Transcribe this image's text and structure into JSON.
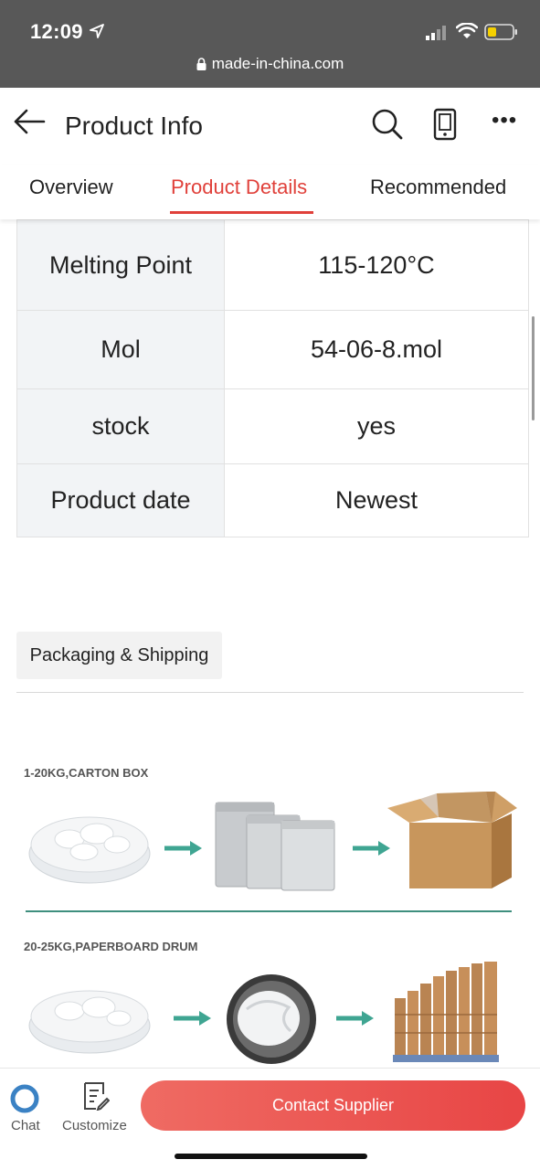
{
  "status_bar": {
    "time": "12:09"
  },
  "url_bar": {
    "domain": "made-in-china.com"
  },
  "header": {
    "title": "Product Info"
  },
  "tabs": [
    {
      "label": "Overview",
      "active": false
    },
    {
      "label": "Product Details",
      "active": true
    },
    {
      "label": "Recommended",
      "active": false
    }
  ],
  "spec_rows": [
    {
      "key": "Melting Point",
      "value": "115-120°C"
    },
    {
      "key": "Mol",
      "value": "54-06-8.mol"
    },
    {
      "key": "stock",
      "value": "yes"
    },
    {
      "key": "Product date",
      "value": "Newest"
    }
  ],
  "packaging": {
    "section_label": "Packaging & Shipping",
    "option1_label": "1-20KG,CARTON BOX",
    "option2_label": "20-25KG,PAPERBOARD DRUM"
  },
  "bottom_bar": {
    "chat_label": "Chat",
    "customize_label": "Customize",
    "contact_label": "Contact Supplier"
  },
  "colors": {
    "accent": "#e0403a",
    "contact_gradient_start": "#ef6b63",
    "contact_gradient_end": "#e84545",
    "chat_icon": "#3b82c4",
    "arrow_teal": "#3fa592"
  }
}
